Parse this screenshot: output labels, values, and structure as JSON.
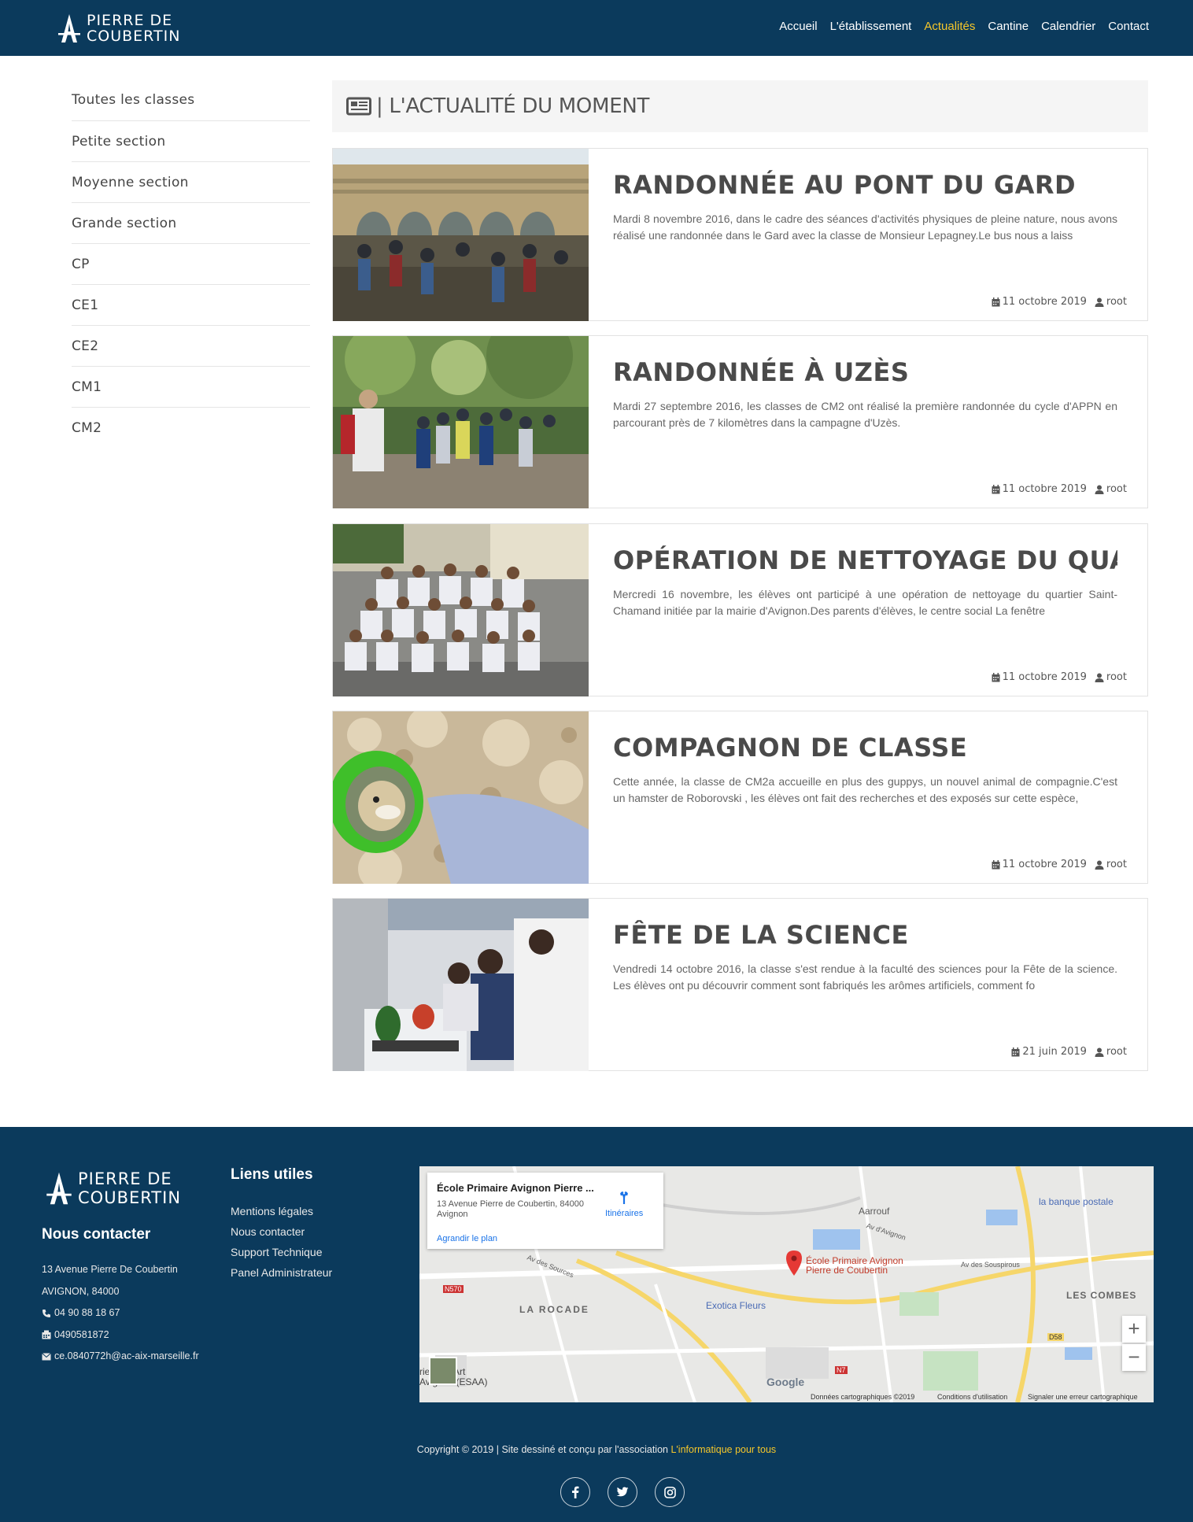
{
  "header": {
    "logo_line1": "PIERRE DE",
    "logo_line2": "COUBERTIN",
    "nav": [
      "Accueil",
      "L'établissement",
      "Actualités",
      "Cantine",
      "Calendrier",
      "Contact"
    ],
    "active_nav": "Actualités"
  },
  "sidebar": {
    "items": [
      "Toutes les classes",
      "Petite section",
      "Moyenne section",
      "Grande section",
      "CP",
      "CE1",
      "CE2",
      "CM1",
      "CM2"
    ]
  },
  "main": {
    "section_title": "| L'ACTUALITÉ DU MOMENT",
    "articles": [
      {
        "title": "RANDONNÉE AU PONT DU GARD",
        "text": "Mardi 8 novembre 2016, dans le cadre des séances d'activités physiques de pleine nature, nous avons réalisé une randonnée dans le Gard avec la classe de Monsieur Lepagney.Le bus nous a laiss",
        "date": "11 octobre 2019",
        "author": "root",
        "image": "photo-pont-du-gard"
      },
      {
        "title": "RANDONNÉE À UZÈS",
        "text": "Mardi 27 septembre 2016, les classes de CM2 ont réalisé la première randonnée du cycle d'APPN en parcourant près de 7 kilomètres dans la campagne d'Uzès.",
        "date": "11 octobre 2019",
        "author": "root",
        "image": "photo-randonnee-uzes"
      },
      {
        "title": "OPÉRATION DE NETTOYAGE DU QUA",
        "text": "Mercredi 16 novembre, les élèves ont participé à une opération de nettoyage du quartier Saint-Chamand initiée par la mairie d'Avignon.Des parents d'élèves, le centre social La fenêtre",
        "date": "11 octobre 2019",
        "author": "root",
        "image": "photo-nettoyage-quartier"
      },
      {
        "title": "COMPAGNON DE CLASSE",
        "text": "Cette année, la classe de CM2a accueille en plus des guppys, un nouvel animal de compagnie.C'est un hamster de Roborovski , les élèves ont fait des recherches et des exposés sur cette espèce,",
        "date": "11 octobre 2019",
        "author": "root",
        "image": "photo-hamster"
      },
      {
        "title": "FÊTE DE LA SCIENCE",
        "text": "Vendredi 14 octobre 2016, la classe s'est rendue à la faculté des sciences pour la Fête de la science. Les élèves ont pu découvrir comment sont fabriqués les arômes artificiels, comment fo",
        "date": "21 juin 2019",
        "author": "root",
        "image": "photo-fete-science"
      }
    ]
  },
  "footer": {
    "logo_line1": "PIERRE DE",
    "logo_line2": "COUBERTIN",
    "contact_title": "Nous contacter",
    "address1": "13 Avenue Pierre De Coubertin",
    "address2": "AVIGNON, 84000",
    "phone": "04 90 88 18 67",
    "fax": "0490581872",
    "email": "ce.0840772h@ac-aix-marseille.fr",
    "links_title": "Liens utiles",
    "links": [
      "Mentions légales",
      "Nous contacter",
      "Support Technique",
      "Panel Administrateur"
    ],
    "copyright_prefix": "Copyright © 2019 | Site dessiné et conçu par l'association ",
    "copyright_link": "L'informatique pour tous",
    "socials": [
      "facebook-icon",
      "twitter-icon",
      "instagram-icon"
    ]
  },
  "map": {
    "place_title": "École Primaire Avignon Pierre ...",
    "place_address": "13 Avenue Pierre de Coubertin, 84000 Avignon",
    "directions": "Itinéraires",
    "enlarge": "Agrandir le plan",
    "pin_label1": "École Primaire Avignon",
    "pin_label2": "Pierre de Coubertin",
    "labels": {
      "aarrouf": "Aarrouf",
      "banque": "la banque postale",
      "rocade": "LA ROCADE",
      "combes": "LES COMBES",
      "exotica": "Exotica Fleurs",
      "google": "Google",
      "esaa1": "rieure d'Art",
      "esaa2": "Avignon (ESAA)",
      "copy": "Données cartographiques ©2019",
      "terms": "Conditions d'utilisation",
      "report": "Signaler une erreur cartographique",
      "av_sources": "Av des Sources",
      "av_avignon": "Av d'Avignon",
      "av_souspirous": "Av des Souspirous",
      "n570": "N570",
      "n7": "N7",
      "d58": "D58"
    },
    "zoom_in": "+",
    "zoom_out": "−"
  },
  "colors": {
    "navy": "#0b3a5c",
    "accent": "#f5c62a"
  }
}
